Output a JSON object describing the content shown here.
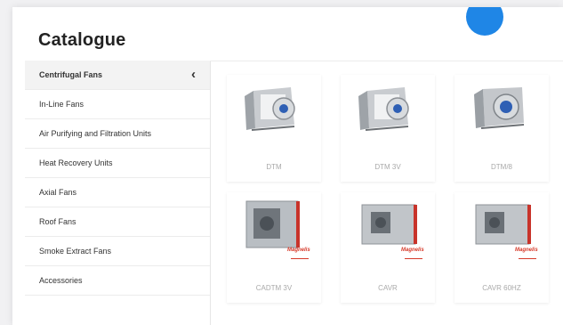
{
  "page": {
    "title": "Catalogue"
  },
  "sidebar": {
    "items": [
      {
        "label": "Centrifugal Fans",
        "active": true
      },
      {
        "label": "In-Line Fans"
      },
      {
        "label": "Air Purifying and Filtration Units"
      },
      {
        "label": "Heat Recovery Units"
      },
      {
        "label": "Axial Fans"
      },
      {
        "label": "Roof Fans"
      },
      {
        "label": "Smoke Extract Fans"
      },
      {
        "label": "Accessories"
      }
    ],
    "active_icon": "chevron-left-icon"
  },
  "products": [
    {
      "name": "DTM",
      "image": "centrifugal-fan-icon"
    },
    {
      "name": "DTM 3V",
      "image": "centrifugal-fan-icon"
    },
    {
      "name": "DTM/8",
      "image": "centrifugal-fan-icon"
    },
    {
      "name": "CADTM 3V",
      "image": "cabinet-fan-icon",
      "badge": "Magnelis"
    },
    {
      "name": "CAVR",
      "image": "cabinet-fan-icon",
      "badge": "Magnelis"
    },
    {
      "name": "CAVR 60HZ",
      "image": "cabinet-fan-icon",
      "badge": "Magnelis"
    }
  ],
  "colors": {
    "accent": "#1f86e6",
    "badge": "#d63a2a"
  }
}
